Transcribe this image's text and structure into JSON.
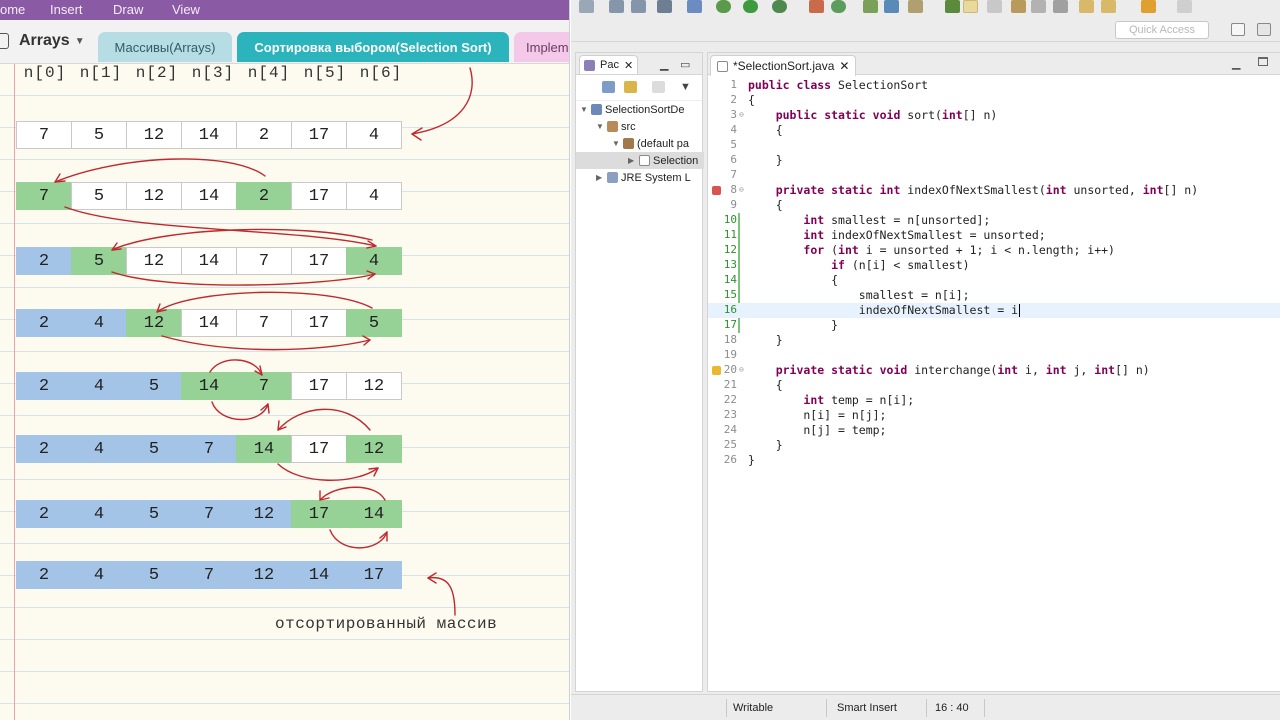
{
  "notebook": {
    "menu": [
      "ome",
      "Insert",
      "Draw",
      "View"
    ],
    "title": "Arrays",
    "tabs": [
      {
        "label": "Массивы(Arrays)",
        "active": false
      },
      {
        "label": "Сортировка выбором(Selection Sort)",
        "active": true
      },
      {
        "label": "Implem",
        "active": false
      }
    ],
    "indices": [
      "n[0]",
      "n[1]",
      "n[2]",
      "n[3]",
      "n[4]",
      "n[5]",
      "n[6]"
    ],
    "rows": [
      {
        "values": [
          "7",
          "5",
          "12",
          "14",
          "2",
          "17",
          "4"
        ],
        "sorted": 0,
        "highlight": []
      },
      {
        "values": [
          "7",
          "5",
          "12",
          "14",
          "2",
          "17",
          "4"
        ],
        "sorted": 0,
        "highlight": [
          0,
          4
        ]
      },
      {
        "values": [
          "2",
          "5",
          "12",
          "14",
          "7",
          "17",
          "4"
        ],
        "sorted": 1,
        "highlight": [
          1,
          6
        ]
      },
      {
        "values": [
          "2",
          "4",
          "12",
          "14",
          "7",
          "17",
          "5"
        ],
        "sorted": 2,
        "highlight": [
          2,
          6
        ]
      },
      {
        "values": [
          "2",
          "4",
          "5",
          "14",
          "7",
          "17",
          "12"
        ],
        "sorted": 3,
        "highlight": [
          3,
          4
        ]
      },
      {
        "values": [
          "2",
          "4",
          "5",
          "7",
          "14",
          "17",
          "12"
        ],
        "sorted": 4,
        "highlight": [
          4,
          6
        ]
      },
      {
        "values": [
          "2",
          "4",
          "5",
          "7",
          "12",
          "17",
          "14"
        ],
        "sorted": 5,
        "highlight": [
          5,
          6
        ]
      },
      {
        "values": [
          "2",
          "4",
          "5",
          "7",
          "12",
          "14",
          "17"
        ],
        "sorted": 7,
        "highlight": []
      }
    ],
    "caption": "отсортированный массив",
    "colors": {
      "sorted": "#a3c4e6",
      "highlight": "#96d196",
      "ink": "#c0282d",
      "menubar": "#8b5aa5",
      "active_tab": "#2cb4bd"
    }
  },
  "eclipse": {
    "quick_access": "Quick Access",
    "package_explorer": {
      "tab_label": "Pac",
      "tree": [
        {
          "label": "SelectionSortDe",
          "level": 0,
          "icon": "project-icon"
        },
        {
          "label": "src",
          "level": 1,
          "icon": "source-folder-icon"
        },
        {
          "label": "(default pa",
          "level": 2,
          "icon": "package-icon"
        },
        {
          "label": "Selection",
          "level": 3,
          "icon": "java-file-icon",
          "selected": true
        },
        {
          "label": "JRE System L",
          "level": 1,
          "icon": "library-icon"
        }
      ]
    },
    "editor": {
      "tab_label": "*SelectionSort.java",
      "lines": [
        {
          "n": "1",
          "code": "public class SelectionSort"
        },
        {
          "n": "2",
          "code": "{"
        },
        {
          "n": "3",
          "code": "    public static void sort(int[] n)"
        },
        {
          "n": "4",
          "code": "    {"
        },
        {
          "n": "5",
          "code": ""
        },
        {
          "n": "6",
          "code": "    }"
        },
        {
          "n": "7",
          "code": ""
        },
        {
          "n": "8",
          "code": "    private static int indexOfNextSmallest(int unsorted, int[] n)"
        },
        {
          "n": "9",
          "code": "    {"
        },
        {
          "n": "10",
          "code": "        int smallest = n[unsorted];"
        },
        {
          "n": "11",
          "code": "        int indexOfNextSmallest = unsorted;"
        },
        {
          "n": "12",
          "code": "        for (int i = unsorted + 1; i < n.length; i++)"
        },
        {
          "n": "13",
          "code": "            if (n[i] < smallest)"
        },
        {
          "n": "14",
          "code": "            {"
        },
        {
          "n": "15",
          "code": "                smallest = n[i];"
        },
        {
          "n": "16",
          "code": "                indexOfNextSmallest = i"
        },
        {
          "n": "17",
          "code": "            }"
        },
        {
          "n": "18",
          "code": "    }"
        },
        {
          "n": "19",
          "code": ""
        },
        {
          "n": "20",
          "code": "    private static void interchange(int i, int j, int[] n)"
        },
        {
          "n": "21",
          "code": "    {"
        },
        {
          "n": "22",
          "code": "        int temp = n[i];"
        },
        {
          "n": "23",
          "code": "        n[i] = n[j];"
        },
        {
          "n": "24",
          "code": "        n[j] = temp;"
        },
        {
          "n": "25",
          "code": "    }"
        },
        {
          "n": "26",
          "code": "}"
        }
      ]
    },
    "status": {
      "mode": "Writable",
      "insert": "Smart Insert",
      "position": "16 : 40"
    }
  }
}
